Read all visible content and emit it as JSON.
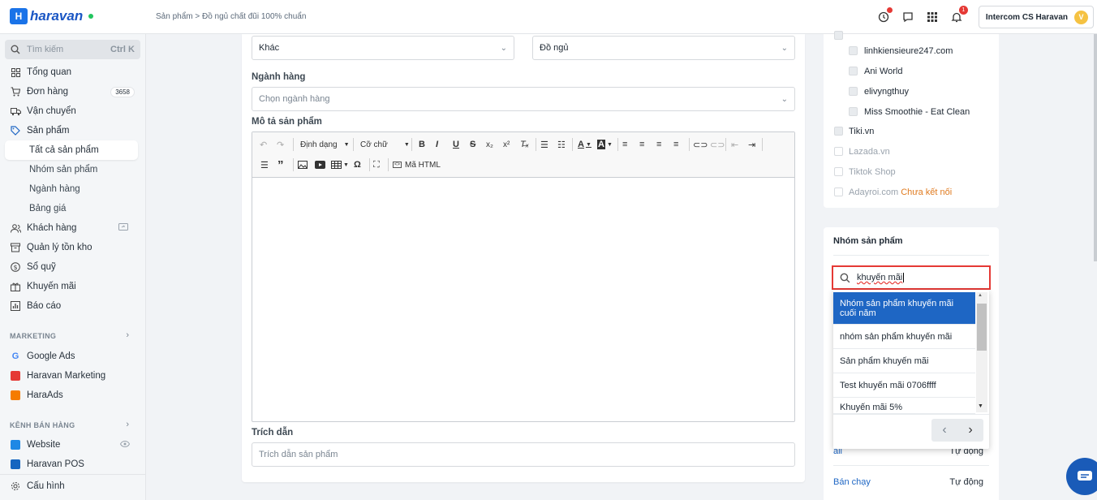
{
  "brand": {
    "name": "haravan"
  },
  "breadcrumb": {
    "parent": "Sản phẩm",
    "current": "Đồ ngủ chất đũi 100% chuẩn"
  },
  "topbar": {
    "notification_count": "1",
    "account_name": "Intercom CS Haravan",
    "avatar_letter": "V"
  },
  "sidebar": {
    "search_placeholder": "Tìm kiếm",
    "search_shortcut": "Ctrl K",
    "items": [
      {
        "label": "Tổng quan"
      },
      {
        "label": "Đơn hàng",
        "count": "3658"
      },
      {
        "label": "Vận chuyển"
      },
      {
        "label": "Sản phẩm"
      },
      {
        "label": "Tất cả sản phẩm"
      },
      {
        "label": "Nhóm sản phẩm"
      },
      {
        "label": "Ngành hàng"
      },
      {
        "label": "Bảng giá"
      },
      {
        "label": "Khách hàng"
      },
      {
        "label": "Quản lý tồn kho"
      },
      {
        "label": "Sổ quỹ"
      },
      {
        "label": "Khuyến mãi"
      },
      {
        "label": "Báo cáo"
      }
    ],
    "marketing_title": "MARKETING",
    "marketing": [
      {
        "label": "Google Ads"
      },
      {
        "label": "Haravan Marketing"
      },
      {
        "label": "HaraAds"
      }
    ],
    "channels_title": "KÊNH BÁN HÀNG",
    "channels": [
      {
        "label": "Website"
      },
      {
        "label": "Haravan POS"
      }
    ],
    "settings": "Cấu hình"
  },
  "form": {
    "type_value": "Khác",
    "vendor_value": "Đồ ngủ",
    "industry_label": "Ngành hàng",
    "industry_placeholder": "Chọn ngành hàng",
    "desc_label": "Mô tả sản phẩm",
    "toolbar": {
      "format": "Định dạng",
      "size": "Cỡ chữ",
      "html": "Mã HTML"
    },
    "excerpt_label": "Trích dẫn",
    "excerpt_placeholder": "Trích dẫn sản phẩm"
  },
  "channels_panel": {
    "shops": [
      "linhkiensieure247.com",
      "Ani World",
      "elivyngthuy",
      "Miss Smoothie - Eat Clean"
    ],
    "tiki": "Tiki.vn",
    "lazada": "Lazada.vn",
    "tiktok": "Tiktok Shop",
    "adayroi": "Adayroi.com",
    "adayroi_status": "Chưa kết nối"
  },
  "groups_panel": {
    "title": "Nhóm sản phẩm",
    "search_value": "khuyến mãi",
    "options": [
      "Nhóm sản phẩm khuyến mãi cuối năm",
      "nhóm sản phẩm khuyến mãi",
      "Sản phẩm khuyến mãi",
      "Test khuyến mãi 0706ffff",
      "Khuyến mãi 5%"
    ],
    "rows": [
      {
        "name": "all",
        "mode": "Tự động"
      },
      {
        "name": "Bán chạy",
        "mode": "Tự động"
      }
    ]
  },
  "colors": {
    "accent": "#1e66c4",
    "highlight_border": "#e53935",
    "warning": "#e07b20"
  }
}
